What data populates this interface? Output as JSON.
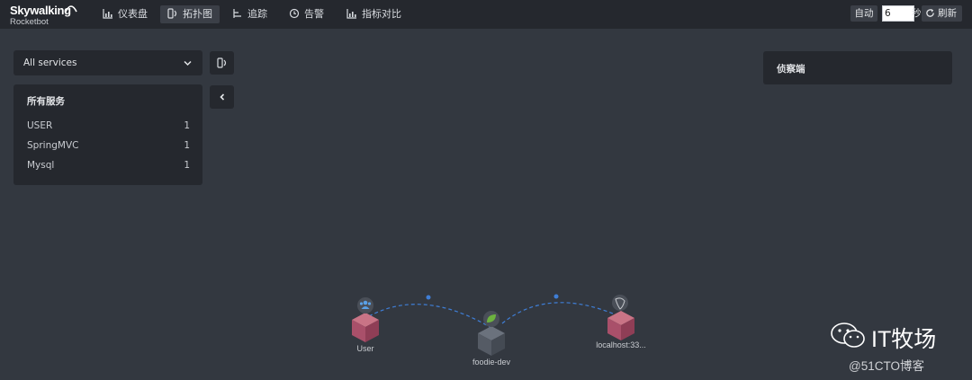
{
  "app": {
    "brand": "Skywalking",
    "brand_sub": "Rocketbot"
  },
  "nav": [
    {
      "label": "仪表盘",
      "icon": "chart-bar-icon"
    },
    {
      "label": "拓扑图",
      "icon": "topology-icon",
      "active": true
    },
    {
      "label": "追踪",
      "icon": "trace-icon"
    },
    {
      "label": "告警",
      "icon": "alarm-icon"
    },
    {
      "label": "指标对比",
      "icon": "chart-bar-icon"
    }
  ],
  "toolbar": {
    "auto_label": "自动",
    "interval_value": "6",
    "interval_unit": "秒",
    "refresh_label": "刷新"
  },
  "left_panel": {
    "service_select": "All services",
    "services_title": "所有服务",
    "services": [
      {
        "name": "USER",
        "count": "1"
      },
      {
        "name": "SpringMVC",
        "count": "1"
      },
      {
        "name": "Mysql",
        "count": "1"
      }
    ]
  },
  "right_panel": {
    "title": "侦察端"
  },
  "topology": {
    "nodes": [
      {
        "label": "User",
        "type": "USER",
        "color": "#b2566b",
        "badge": "users-icon"
      },
      {
        "label": "foodie-dev",
        "type": "SpringMVC",
        "color": "#545b66",
        "badge": "leaf-icon"
      },
      {
        "label": "localhost:33...",
        "type": "Mysql",
        "color": "#b2566b",
        "badge": "database-icon"
      }
    ],
    "link_color": "#3f7ed6"
  },
  "watermark": {
    "main": "IT牧场",
    "sub": "@51CTO博客"
  }
}
